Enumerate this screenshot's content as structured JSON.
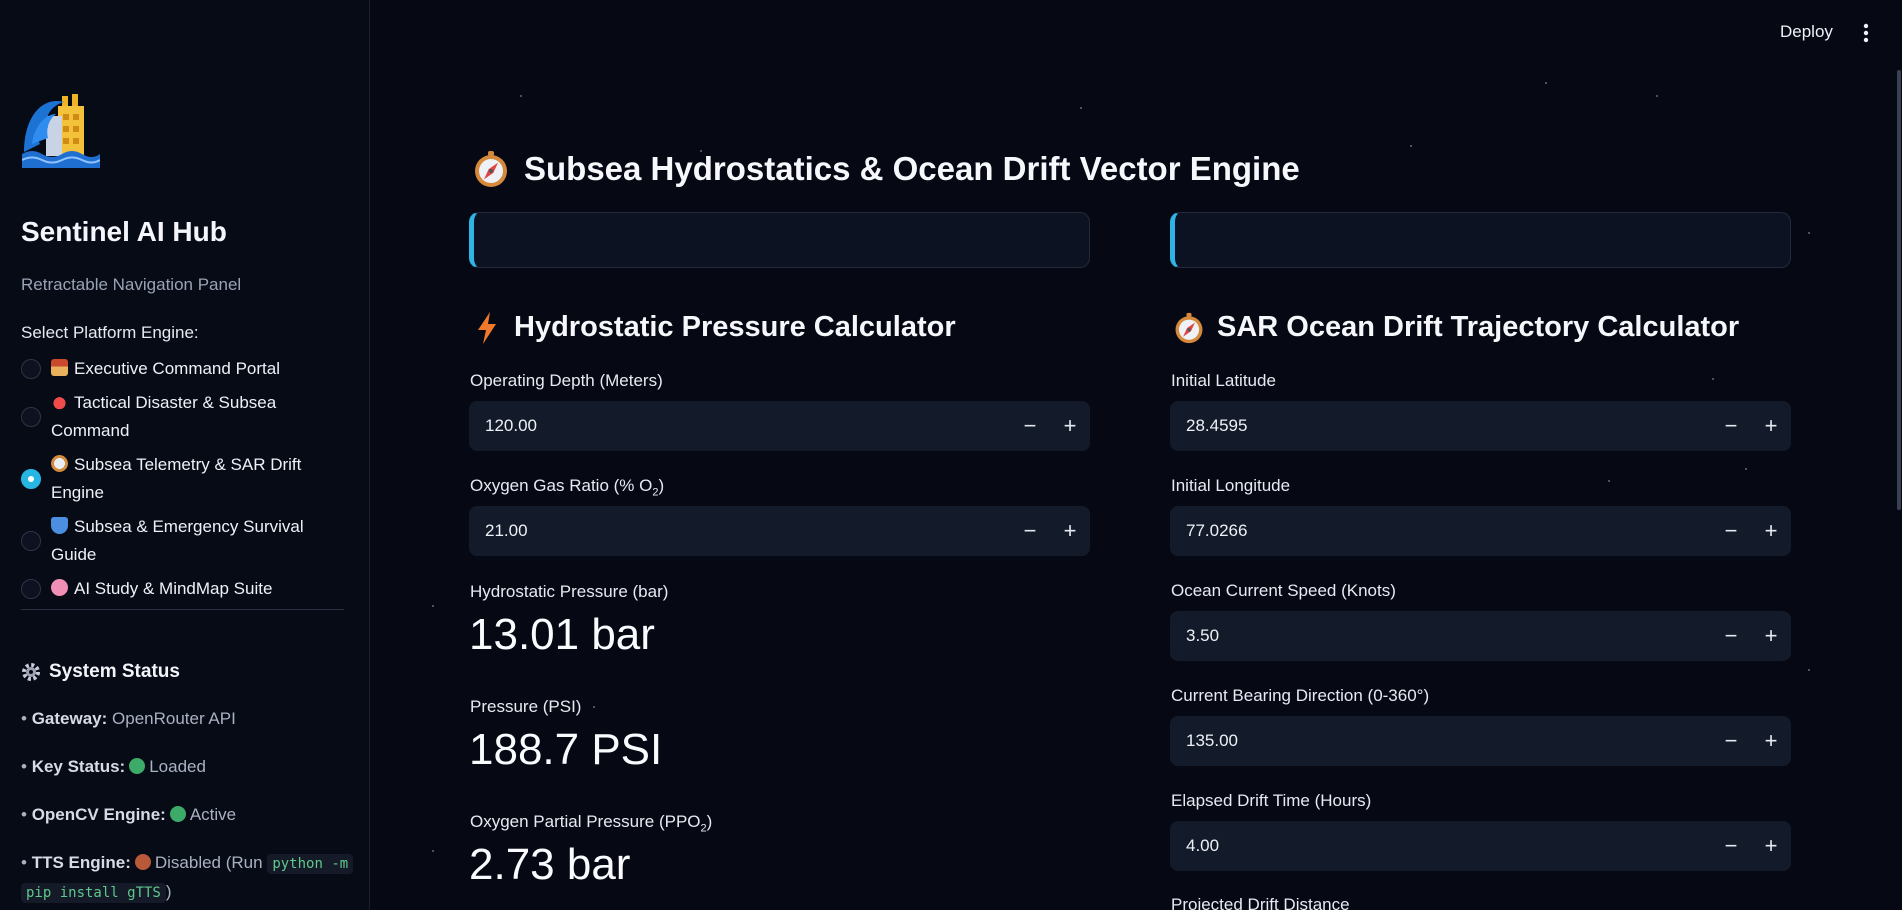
{
  "header": {
    "deploy_label": "Deploy"
  },
  "sidebar": {
    "title": "Sentinel AI Hub",
    "subtitle": "Retractable Navigation Panel",
    "select_label": "Select Platform Engine:",
    "items": [
      {
        "label": "Executive Command Portal",
        "icon": "house-icon",
        "selected": false
      },
      {
        "label": "Tactical Disaster & Subsea Command",
        "icon": "siren-icon",
        "selected": false
      },
      {
        "label": "Subsea Telemetry & SAR Drift Engine",
        "icon": "compass-icon",
        "selected": true
      },
      {
        "label": "Subsea & Emergency Survival Guide",
        "icon": "shield-icon",
        "selected": false
      },
      {
        "label": "AI Study & MindMap Suite",
        "icon": "brain-icon",
        "selected": false
      }
    ],
    "status": {
      "title": "System Status",
      "gateway_key": "Gateway:",
      "gateway_val": "OpenRouter API",
      "key_key": "Key Status:",
      "key_val": "Loaded",
      "opencv_key": "OpenCV Engine:",
      "opencv_val": "Active",
      "tts_key": "TTS Engine:",
      "tts_val": "Disabled (Run",
      "tts_code_1": "python -m",
      "tts_code_2": "pip install gTTS",
      "tts_close": ")"
    }
  },
  "main": {
    "title": "Subsea Hydrostatics & Ocean Drift Vector Engine",
    "left": {
      "title": "Hydrostatic Pressure Calculator",
      "depth_label": "Operating Depth (Meters)",
      "depth_value": "120.00",
      "oxygen_label_pre": "Oxygen Gas Ratio (% O",
      "oxygen_label_sub": "2",
      "oxygen_label_post": ")",
      "oxygen_value": "21.00",
      "m1_label": "Hydrostatic Pressure (bar)",
      "m1_value": "13.01 bar",
      "m2_label": "Pressure (PSI)",
      "m2_value": "188.7 PSI",
      "m3_label_pre": "Oxygen Partial Pressure (PPO",
      "m3_label_sub": "2",
      "m3_label_post": ")",
      "m3_value": "2.73 bar"
    },
    "right": {
      "title": "SAR Ocean Drift Trajectory Calculator",
      "lat_label": "Initial Latitude",
      "lat_value": "28.4595",
      "lon_label": "Initial Longitude",
      "lon_value": "77.0266",
      "speed_label": "Ocean Current Speed (Knots)",
      "speed_value": "3.50",
      "bearing_label": "Current Bearing Direction (0-360°)",
      "bearing_value": "135.00",
      "time_label": "Elapsed Drift Time (Hours)",
      "time_value": "4.00",
      "projected_label": "Projected Drift Distance"
    },
    "stepper": {
      "minus": "−",
      "plus": "+"
    }
  },
  "colors": {
    "accent": "#2fb4e6",
    "background": "#060914",
    "input_bg": "#131a2a"
  }
}
